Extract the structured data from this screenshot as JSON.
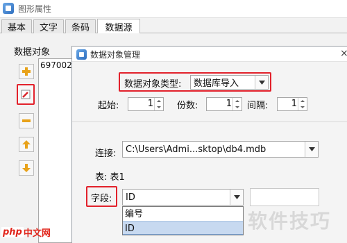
{
  "window": {
    "title": "图形属性"
  },
  "tabs": [
    {
      "label": "基本"
    },
    {
      "label": "文字"
    },
    {
      "label": "条码"
    },
    {
      "label": "数据源"
    }
  ],
  "panel": {
    "data_object_label": "数据对象",
    "list_items": [
      "697002"
    ]
  },
  "side_buttons": [
    {
      "name": "add",
      "icon": "plus-icon"
    },
    {
      "name": "edit",
      "icon": "edit-icon"
    },
    {
      "name": "remove",
      "icon": "minus-icon"
    },
    {
      "name": "move-up",
      "icon": "arrow-up-icon"
    },
    {
      "name": "move-down",
      "icon": "arrow-down-icon"
    }
  ],
  "dialog": {
    "title": "数据对象管理",
    "close_label": "×",
    "type_label": "数据对象类型:",
    "type_value": "数据库导入",
    "start_label": "起始:",
    "start_value": "1",
    "copies_label": "份数:",
    "copies_value": "1",
    "interval_label": "间隔:",
    "interval_value": "1",
    "connection_label": "连接:",
    "connection_value": "C:\\Users\\Admi...sktop\\db4.mdb",
    "table_label": "表: 表1",
    "field_label": "字段:",
    "field_value": "ID",
    "field_options": [
      "编号",
      "ID"
    ],
    "field_selected_index": 1
  },
  "watermark": {
    "text": "软件技巧",
    "logo_php": "php",
    "logo_cn": "中文网"
  },
  "colors": {
    "highlight_border": "#e2212b",
    "selection_bg": "#c7d9f0"
  }
}
